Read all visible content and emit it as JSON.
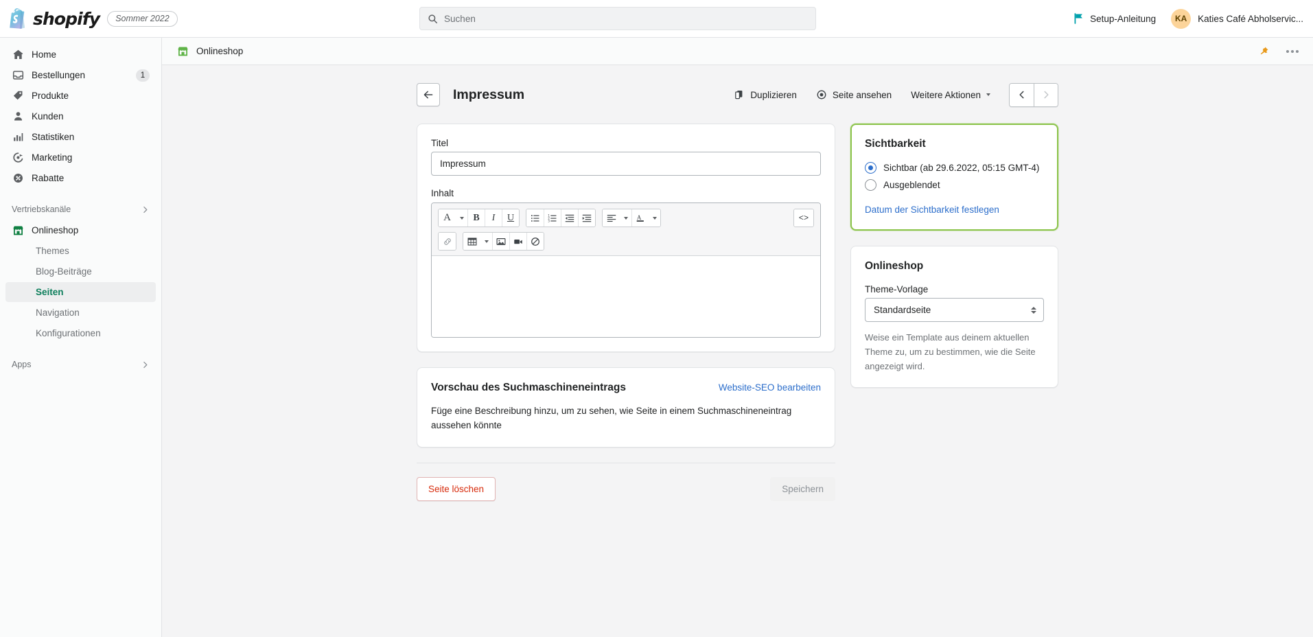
{
  "topbar": {
    "brand_name": "shopify",
    "season_badge": "Sommer 2022",
    "search_placeholder": "Suchen",
    "setup_guide_label": "Setup-Anleitung",
    "avatar_initials": "KA",
    "account_name": "Katies Café Abholservic...",
    "accent_teal": "#00a0ac",
    "avatar_bg": "#fcd49a"
  },
  "sidebar": {
    "items": [
      {
        "label": "Home",
        "icon": "home-icon",
        "badge": ""
      },
      {
        "label": "Bestellungen",
        "icon": "orders-icon",
        "badge": "1"
      },
      {
        "label": "Produkte",
        "icon": "products-icon",
        "badge": ""
      },
      {
        "label": "Kunden",
        "icon": "customers-icon",
        "badge": ""
      },
      {
        "label": "Statistiken",
        "icon": "analytics-icon",
        "badge": ""
      },
      {
        "label": "Marketing",
        "icon": "marketing-icon",
        "badge": ""
      },
      {
        "label": "Rabatte",
        "icon": "discounts-icon",
        "badge": ""
      }
    ],
    "sections": [
      {
        "label": "Vertriebskanäle",
        "icon": "chevron-right-icon"
      },
      {
        "label": "Apps",
        "icon": "chevron-right-icon"
      }
    ],
    "channel": {
      "label": "Onlineshop",
      "icon": "online-store-icon"
    },
    "sub_items": [
      {
        "label": "Themes",
        "active": false
      },
      {
        "label": "Blog-Beiträge",
        "active": false
      },
      {
        "label": "Seiten",
        "active": true
      },
      {
        "label": "Navigation",
        "active": false
      },
      {
        "label": "Konfigurationen",
        "active": false
      }
    ],
    "active_color": "#0e7f5c"
  },
  "contextbar": {
    "label": "Onlineshop",
    "icon": "online-store-icon",
    "pin_icon": "pin-icon",
    "more_icon": "more-horizontal-icon",
    "pin_color": "#e89a1c"
  },
  "page_header": {
    "back_icon": "arrow-left-icon",
    "title": "Impressum",
    "duplicate_label": "Duplizieren",
    "duplicate_icon": "duplicate-icon",
    "view_page_label": "Seite ansehen",
    "view_page_icon": "eye-icon",
    "more_actions_label": "Weitere Aktionen",
    "more_actions_icon": "chevron-down-icon",
    "prev_icon": "chevron-left-icon",
    "next_icon": "chevron-right-icon",
    "prev_enabled": true,
    "next_enabled": false
  },
  "content_card": {
    "title_label": "Titel",
    "title_value": "Impressum",
    "title_placeholder": "",
    "content_label": "Inhalt",
    "content_value": "",
    "toolbar": {
      "row1": [
        {
          "name": "format-text-button",
          "glyph": "A",
          "caret": true,
          "style": "serif"
        },
        {
          "name": "bold-button",
          "glyph": "B",
          "caret": false,
          "style": "bold"
        },
        {
          "name": "italic-button",
          "glyph": "I",
          "caret": false,
          "style": "italic"
        },
        {
          "name": "underline-button",
          "glyph": "U",
          "caret": false,
          "style": "underline"
        }
      ],
      "row1b": [
        {
          "name": "bulleted-list-button",
          "glyph": "ul"
        },
        {
          "name": "numbered-list-button",
          "glyph": "ol"
        },
        {
          "name": "outdent-button",
          "glyph": "outdent"
        },
        {
          "name": "indent-button",
          "glyph": "indent"
        }
      ],
      "row1c": [
        {
          "name": "align-button",
          "glyph": "align",
          "caret": true
        },
        {
          "name": "text-color-button",
          "glyph": "A-color",
          "caret": true
        }
      ],
      "code_button": {
        "name": "show-html-button",
        "glyph": "<>"
      },
      "row2": [
        {
          "name": "insert-link-button",
          "glyph": "link"
        },
        {
          "name": "insert-table-button",
          "glyph": "table",
          "caret": true
        },
        {
          "name": "insert-image-button",
          "glyph": "image"
        },
        {
          "name": "insert-video-button",
          "glyph": "video"
        },
        {
          "name": "clear-formatting-button",
          "glyph": "clear"
        }
      ]
    }
  },
  "seo_card": {
    "title": "Vorschau des Suchmaschineneintrags",
    "edit_link": "Website-SEO bearbeiten",
    "body": "Füge eine Beschreibung hinzu, um zu sehen, wie Seite in einem Suchmaschineneintrag aussehen könnte"
  },
  "visibility_card": {
    "title": "Sichtbarkeit",
    "options": [
      {
        "label": "Sichtbar (ab 29.6.2022, 05:15 GMT-4)",
        "selected": true
      },
      {
        "label": "Ausgeblendet",
        "selected": false
      }
    ],
    "set_date_link": "Datum der Sichtbarkeit festlegen",
    "focus_border_color": "#8bc34a"
  },
  "online_store_card": {
    "title": "Onlineshop",
    "template_label": "Theme-Vorlage",
    "template_value": "Standardseite",
    "help_text": "Weise ein Template aus deinem aktuellen Theme zu, um zu bestimmen, wie die Seite angezeigt wird."
  },
  "footer": {
    "delete_label": "Seite löschen",
    "save_label": "Speichern",
    "save_enabled": false,
    "danger_color": "#d72c0d"
  }
}
